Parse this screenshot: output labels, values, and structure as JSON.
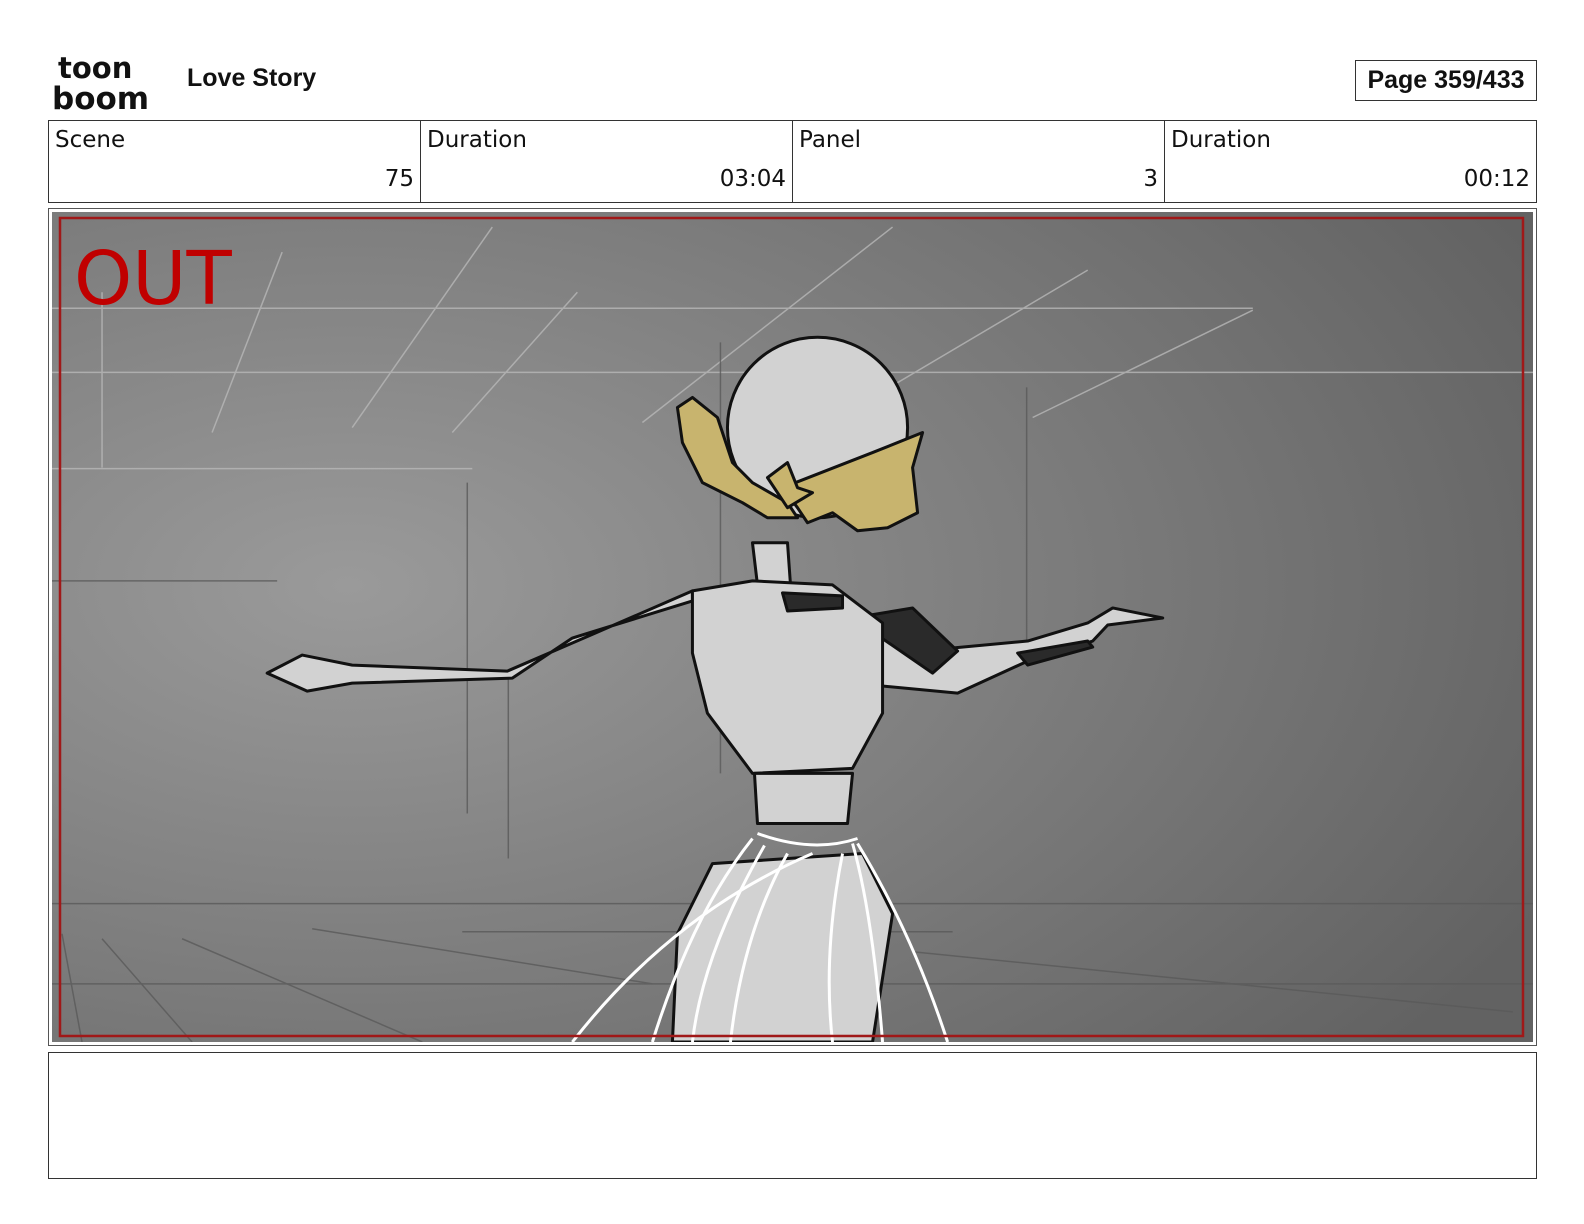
{
  "header": {
    "logo_line1": "toon",
    "logo_line2": "boom",
    "project_title": "Love Story",
    "page_label": "Page 359/433"
  },
  "info": [
    {
      "label": "Scene",
      "value": "75"
    },
    {
      "label": "Duration",
      "value": "03:04"
    },
    {
      "label": "Panel",
      "value": "3"
    },
    {
      "label": "Duration",
      "value": "00:12"
    }
  ],
  "panel": {
    "overlay_text": "OUT",
    "overlay_color": "#c00000",
    "safe_frame_color": "#a01818",
    "hair_color": "#c8b46e",
    "figure_color": "#d2d2d2",
    "background_color": "#7a7a7a"
  },
  "notes": {
    "text": ""
  }
}
